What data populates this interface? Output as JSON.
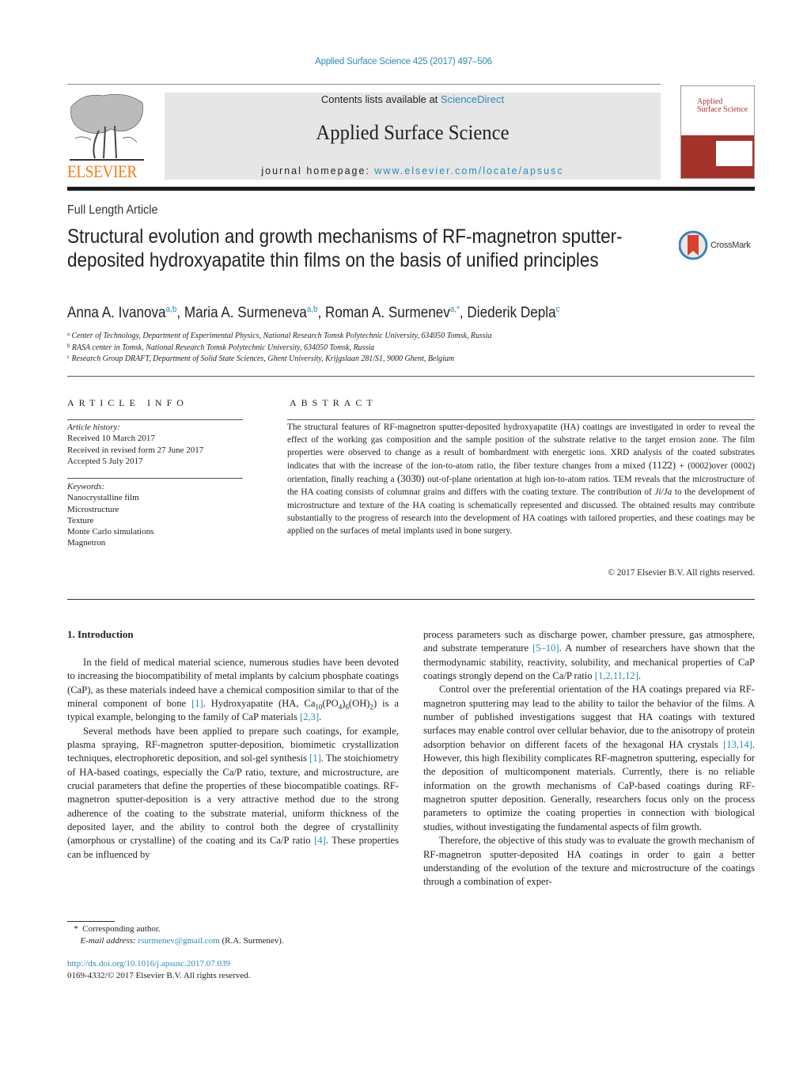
{
  "header": {
    "citation": "Applied Surface Science 425 (2017) 497–506",
    "contents_prefix": "Contents lists available at ",
    "contents_link": "ScienceDirect",
    "journal_name": "Applied Surface Science",
    "homepage_prefix": "journal homepage: ",
    "homepage_link": "www.elsevier.com/locate/apsusc",
    "publisher_logo_text": "ELSEVIER",
    "cover_title_line1": "Applied",
    "cover_title_line2": "Surface Science",
    "crossmark_label": "CrossMark",
    "brand_colors": {
      "link": "#2a8bb7",
      "elsevier_orange": "#f07f1b",
      "cover_red": "#a3322b"
    }
  },
  "article": {
    "type": "Full Length Article",
    "title": "Structural evolution and growth mechanisms of RF-magnetron sputter-deposited hydroxyapatite thin films on the basis of unified principles",
    "authors": [
      {
        "name": "Anna A. Ivanova",
        "affil": "a,b"
      },
      {
        "name": "Maria A. Surmeneva",
        "affil": "a,b"
      },
      {
        "name": "Roman A. Surmenev",
        "affil": "a,*"
      },
      {
        "name": "Diederik Depla",
        "affil": "c"
      }
    ],
    "affiliations": [
      {
        "key": "a",
        "text": "Center of Technology, Department of Experimental Physics, National Research Tomsk Polytechnic University, 634050 Tomsk, Russia"
      },
      {
        "key": "b",
        "text": "RASA center in Tomsk, National Research Tomsk Polytechnic University, 634050 Tomsk, Russia"
      },
      {
        "key": "c",
        "text": "Research Group DRAFT, Department of Solid State Sciences, Ghent University, Krijgslaan 281/S1, 9000 Ghent, Belgium"
      }
    ]
  },
  "article_info": {
    "heading": "ARTICLE INFO",
    "history_label": "Article history:",
    "history": [
      "Received 10 March 2017",
      "Received in revised form 27 June 2017",
      "Accepted 5 July 2017"
    ],
    "keywords_label": "Keywords:",
    "keywords": [
      "Nanocrystalline film",
      "Microstructure",
      "Texture",
      "Monte Carlo simulations",
      "Magnetron"
    ]
  },
  "abstract": {
    "heading": "ABSTRACT",
    "part1": "The structural features of RF-magnetron sputter-deposited hydroxyapatite (HA) coatings are investigated in order to reveal the effect of the working gas composition and the sample position of the substrate relative to the target erosion zone. The film properties were observed to change as a result of bombardment with energetic ions. XRD analysis of the coated substrates indicates that with the increase of the ion-to-atom ratio, the fiber texture changes from a mixed ",
    "miller1": "(112̄2)",
    "part2": " + (0002)over (0002) orientation, finally reaching a ",
    "miller2": "(303̄0)",
    "part3": " out-of-plane orientation at high ion-to-atom ratios. TEM reveals that the microstructure of the HA coating consists of columnar grains and differs with the coating texture. The contribution of ",
    "ratio": "Ji/Ja",
    "part4": " to the development of microstructure and texture of the HA coating is schematically represented and discussed. The obtained results may contribute substantially to the progress of research into the development of HA coatings with tailored properties, and these coatings may be applied on the surfaces of metal implants used in bone surgery.",
    "copyright": "© 2017 Elsevier B.V. All rights reserved."
  },
  "body": {
    "section_heading": "1.  Introduction",
    "left": {
      "p1_a": "In the field of medical material science, numerous studies have been devoted to increasing the biocompatibility of metal implants by calcium phosphate coatings (CaP), as these materials indeed have a chemical composition similar to that of the mineral component of bone ",
      "p1_ref1": "[1]",
      "p1_b": ". Hydroxyapatite (HA, Ca",
      "p1_sub1": "10",
      "p1_c": "(PO",
      "p1_sub2": "4",
      "p1_d": ")",
      "p1_sub3": "6",
      "p1_e": "(OH)",
      "p1_sub4": "2",
      "p1_f": ") is a typical example, belonging to the family of CaP materials ",
      "p1_ref2": "[2,3]",
      "p1_g": ".",
      "p2_a": "Several methods have been applied to prepare such coatings, for example, plasma spraying, RF-magnetron sputter-deposition, biomimetic crystallization techniques, electrophoretic deposition, and sol-gel synthesis ",
      "p2_ref1": "[1]",
      "p2_b": ". The stoichiometry of HA-based coatings, especially the Ca/P ratio, texture, and microstructure, are crucial parameters that define the properties of these biocompatible coatings. RF-magnetron sputter-deposition is a very attractive method due to the strong adherence of the coating to the substrate material, uniform thickness of the deposited layer, and the ability to control both the degree of crystallinity (amorphous or crystalline) of the coating and its Ca/P ratio ",
      "p2_ref2": "[4]",
      "p2_c": ". These properties can be influenced by"
    },
    "right": {
      "p1_a": "process parameters such as discharge power, chamber pressure, gas atmosphere, and substrate temperature ",
      "p1_ref1": "[5–10]",
      "p1_b": ". A number of researchers have shown that the thermodynamic stability, reactivity, solubility, and mechanical properties of CaP coatings strongly depend on the Ca/P ratio ",
      "p1_ref2": "[1,2,11,12]",
      "p1_c": ".",
      "p2_a": "Control over the preferential orientation of the HA coatings prepared via RF-magnetron sputtering may lead to the ability to tailor the behavior of the films. A number of published investigations suggest that HA coatings with textured surfaces may enable control over cellular behavior, due to the anisotropy of protein adsorption behavior on different facets of the hexagonal HA crystals ",
      "p2_ref1": "[13,14]",
      "p2_b": ". However, this high flexibility complicates RF-magnetron sputtering, especially for the deposition of multicomponent materials. Currently, there is no reliable information on the growth mechanisms of CaP-based coatings during RF-magnetron sputter deposition. Generally, researchers focus only on the process parameters to optimize the coating properties in connection with biological studies, without investigating the fundamental aspects of film growth.",
      "p3": "Therefore, the objective of this study was to evaluate the growth mechanism of RF-magnetron sputter-deposited HA coatings in order to gain a better understanding of the evolution of the texture and microstructure of the coatings through a combination of exper-"
    }
  },
  "footnotes": {
    "star": "*",
    "corresponding": "Corresponding author.",
    "email_label": "E-mail address:",
    "email": "rsurmenev@gmail.com",
    "email_suffix": " (R.A. Surmenev).",
    "doi_link": "http://dx.doi.org/10.1016/j.apsusc.2017.07.039",
    "issn_line": "0169-4332/© 2017 Elsevier B.V. All rights reserved."
  }
}
